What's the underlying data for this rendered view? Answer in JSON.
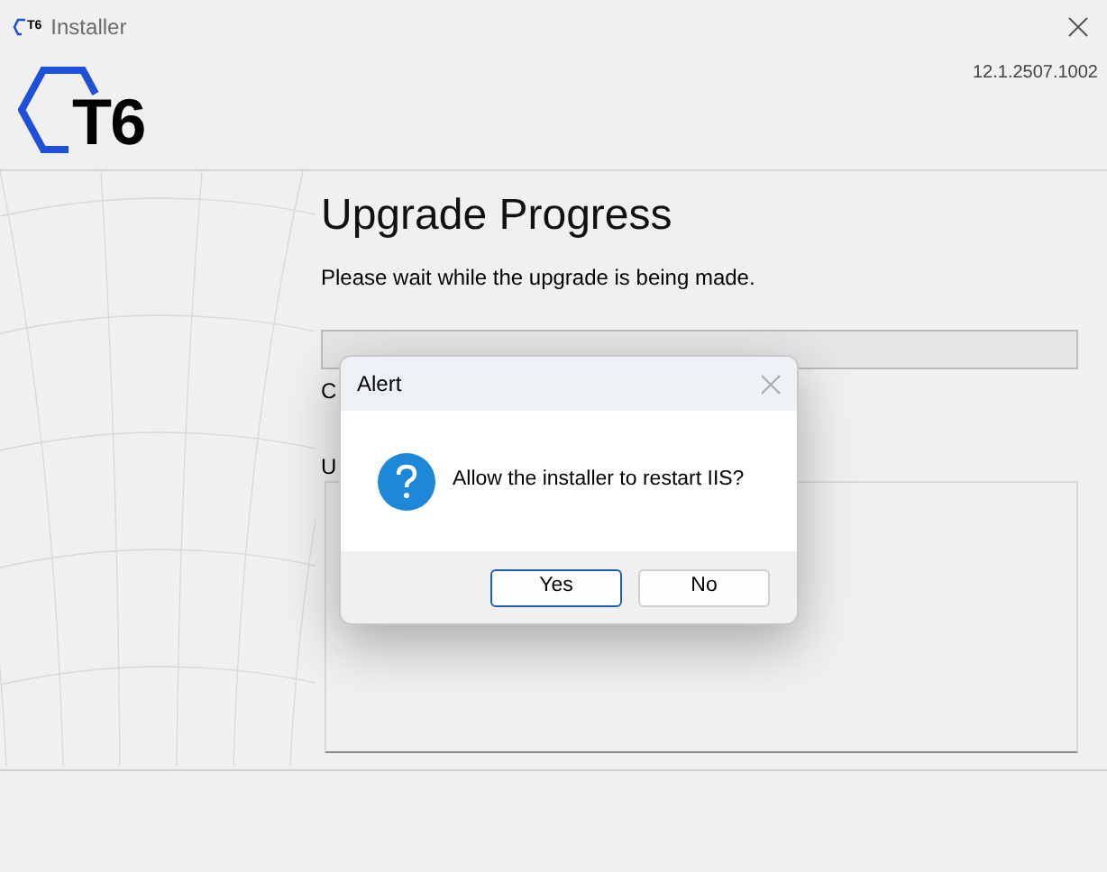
{
  "window": {
    "icon_text": "T6",
    "title": "Installer"
  },
  "header": {
    "logo_text": "T6",
    "version": "12.1.2507.1002"
  },
  "page": {
    "title": "Upgrade Progress",
    "subtitle": "Please wait while the upgrade is being made.",
    "progress": {
      "level": 0
    },
    "status_label": "C",
    "log_label": "U"
  },
  "dialog": {
    "title": "Alert",
    "message": "Allow the installer to restart IIS?",
    "buttons": [
      {
        "label": "Yes",
        "selected": true
      },
      {
        "label": "No",
        "selected": false
      }
    ]
  }
}
